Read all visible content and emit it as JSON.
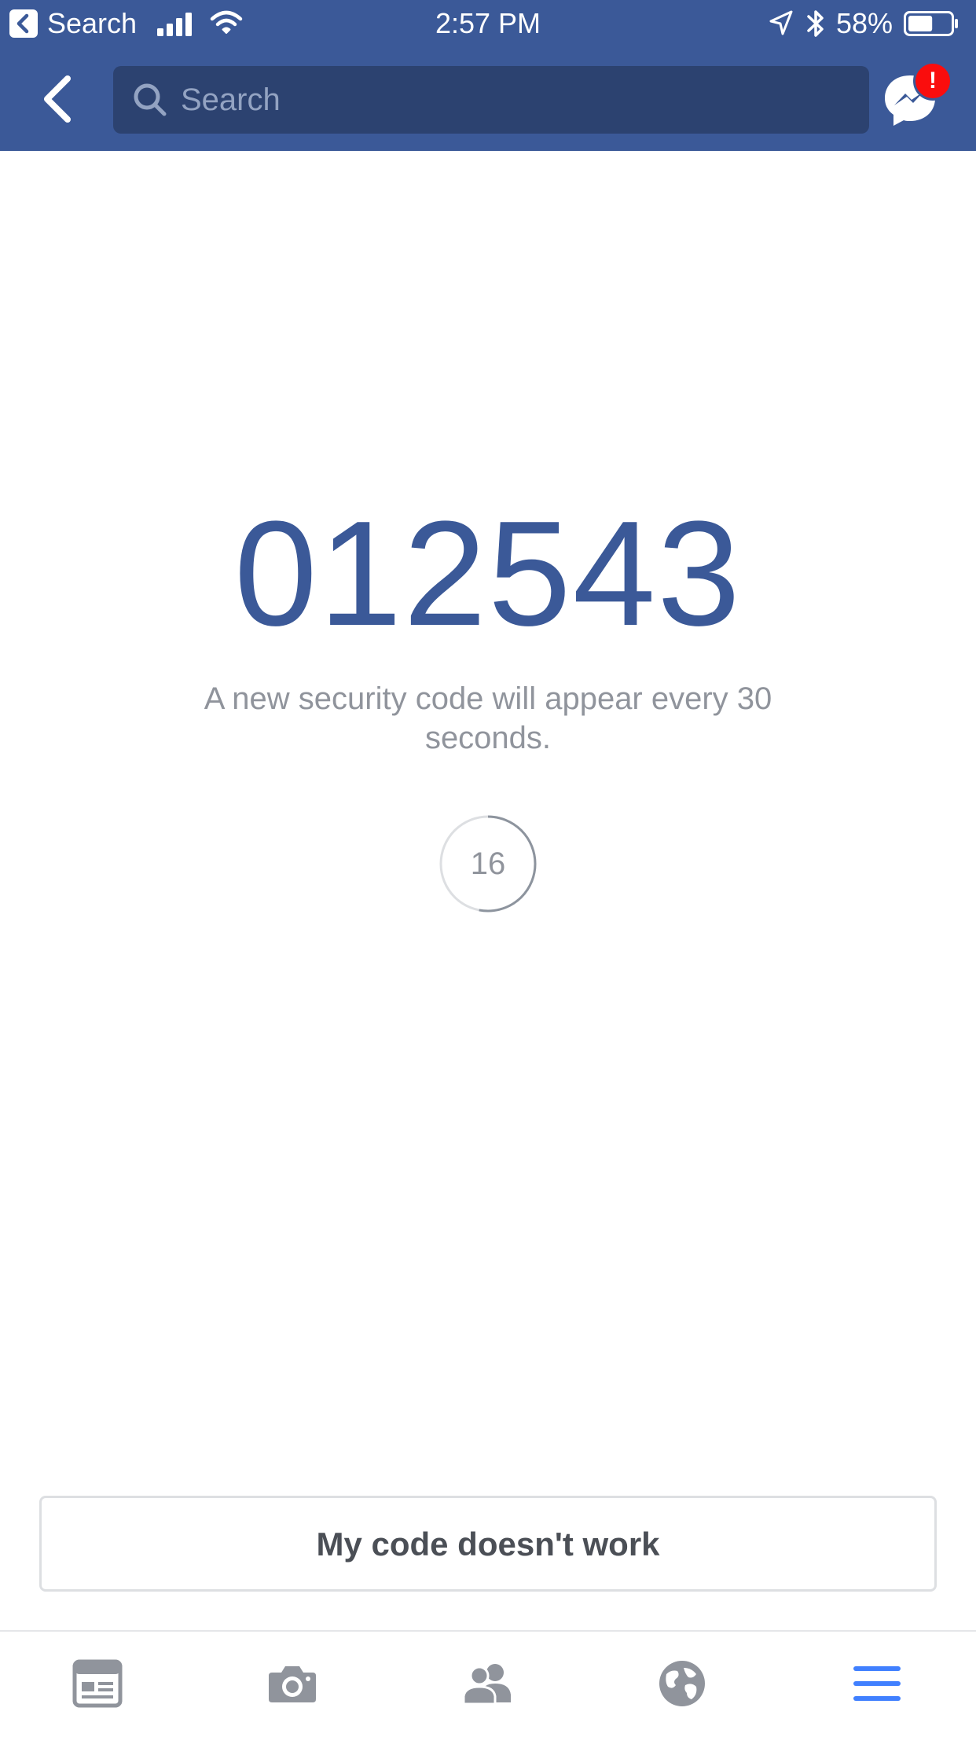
{
  "status_bar": {
    "back_app_label": "Search",
    "time": "2:57 PM",
    "battery_percent": "58%",
    "battery_level": 0.58
  },
  "navbar": {
    "search_placeholder": "Search",
    "messenger_badge": "!"
  },
  "main": {
    "security_code": "012543",
    "info_text": "A new security code will appear every 30 seconds.",
    "countdown_value": "16",
    "countdown_fraction": 0.53,
    "code_help_button_label": "My code doesn't work"
  },
  "tabs": [
    {
      "icon": "news-feed-icon",
      "active": false
    },
    {
      "icon": "camera-icon",
      "active": false
    },
    {
      "icon": "friends-icon",
      "active": false
    },
    {
      "icon": "globe-icon",
      "active": false
    },
    {
      "icon": "menu-icon",
      "active": true
    }
  ],
  "colors": {
    "brand_blue": "#3b5998",
    "search_field_bg": "#2c4270",
    "secondary_text": "#90949c",
    "active_tab": "#4080ff",
    "inactive_tab": "#90949c",
    "badge_red": "#fa0d0d"
  }
}
